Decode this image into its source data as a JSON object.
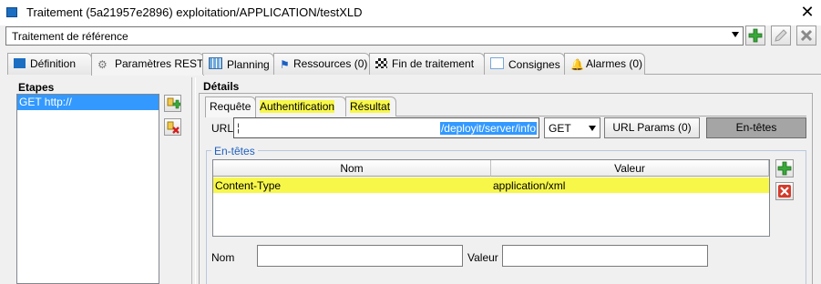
{
  "window": {
    "title": "Traitement (5a21957e2896) exploitation/APPLICATION/testXLD"
  },
  "toolbar": {
    "selected": "Traitement de référence"
  },
  "tabs": [
    {
      "label": "Définition"
    },
    {
      "label": "Paramètres REST"
    },
    {
      "label": "Planning"
    },
    {
      "label": "Ressources (0)"
    },
    {
      "label": "Fin de traitement"
    },
    {
      "label": "Consignes"
    },
    {
      "label": "Alarmes (0)"
    }
  ],
  "steps": {
    "label": "Etapes",
    "items": [
      "GET http://"
    ]
  },
  "details": {
    "label": "Détails",
    "subtabs": [
      {
        "label": "Requête"
      },
      {
        "label": "Authentification"
      },
      {
        "label": "Résultat"
      }
    ],
    "url_label": "URL",
    "url_value": "/deployit/server/info",
    "method": "GET",
    "params_button": "URL Params (0)",
    "headers_button": "En-têtes",
    "headers": {
      "section_label": "En-têtes",
      "columns": [
        "Nom",
        "Valeur"
      ],
      "rows": [
        {
          "name": "Content-Type",
          "value": "application/xml"
        }
      ]
    },
    "nom_label": "Nom",
    "valeur_label": "Valeur"
  },
  "colors": {
    "highlight": "#f7f74a",
    "selection": "#3399ff",
    "group_label": "#1f5fbf"
  }
}
